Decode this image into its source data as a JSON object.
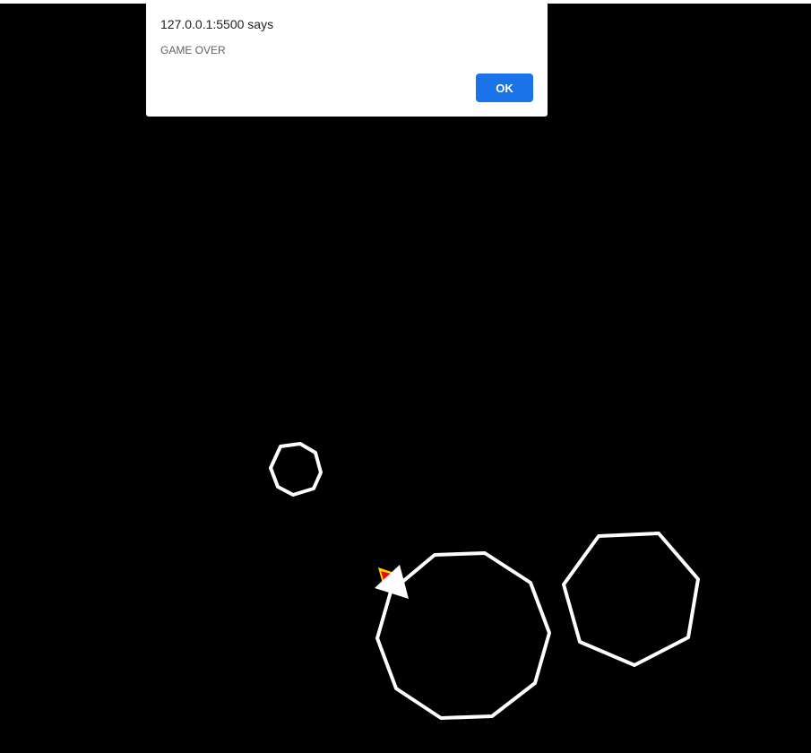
{
  "alert": {
    "origin": "127.0.0.1:5500 says",
    "message": "GAME OVER",
    "ok_label": "OK"
  },
  "colors": {
    "background": "#000000",
    "asteroid_stroke": "#ffffff",
    "ship": "#ffffff",
    "thruster_outer": "#ffd700",
    "thruster_inner": "#ff0000",
    "button": "#1a73e8"
  },
  "game": {
    "asteroid_count": 3,
    "state": "game over"
  }
}
